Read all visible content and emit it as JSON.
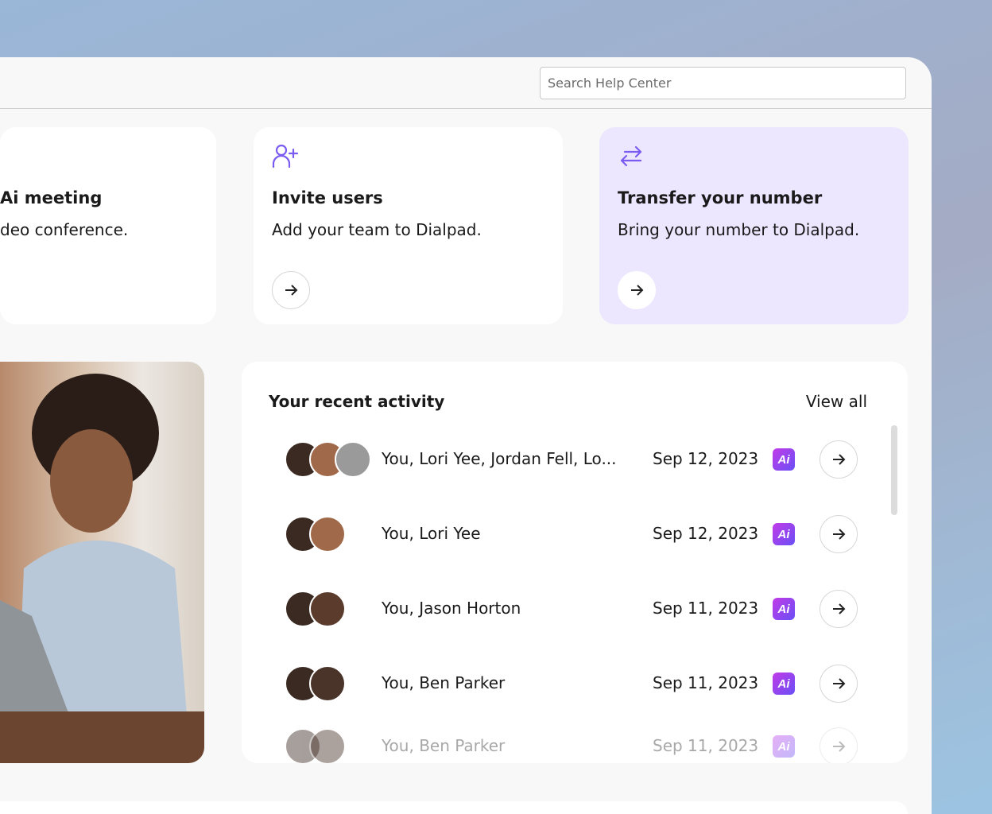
{
  "search": {
    "placeholder": "Search Help Center"
  },
  "cards": [
    {
      "title": "Ai meeting",
      "desc": "deo conference.",
      "icon": "video-icon"
    },
    {
      "title": "Invite users",
      "desc": "Add your team to Dialpad.",
      "icon": "user-plus-icon"
    },
    {
      "title": "Transfer your number",
      "desc": "Bring your number to Dialpad.",
      "icon": "transfer-arrows-icon"
    }
  ],
  "activity": {
    "title": "Your recent activity",
    "view_all": "View all",
    "ai_badge": "Ai",
    "rows": [
      {
        "names": "You, Lori Yee, Jordan Fell, Lo...",
        "date": "Sep 12, 2023"
      },
      {
        "names": "You, Lori Yee",
        "date": "Sep 12, 2023"
      },
      {
        "names": "You, Jason Horton",
        "date": "Sep 11, 2023"
      },
      {
        "names": "You, Ben Parker",
        "date": "Sep 11, 2023"
      },
      {
        "names": "You, Ben Parker",
        "date": "Sep 11, 2023"
      }
    ]
  },
  "colors": {
    "accent": "#7b5cf0",
    "highlight_card": "#ece6ff"
  }
}
